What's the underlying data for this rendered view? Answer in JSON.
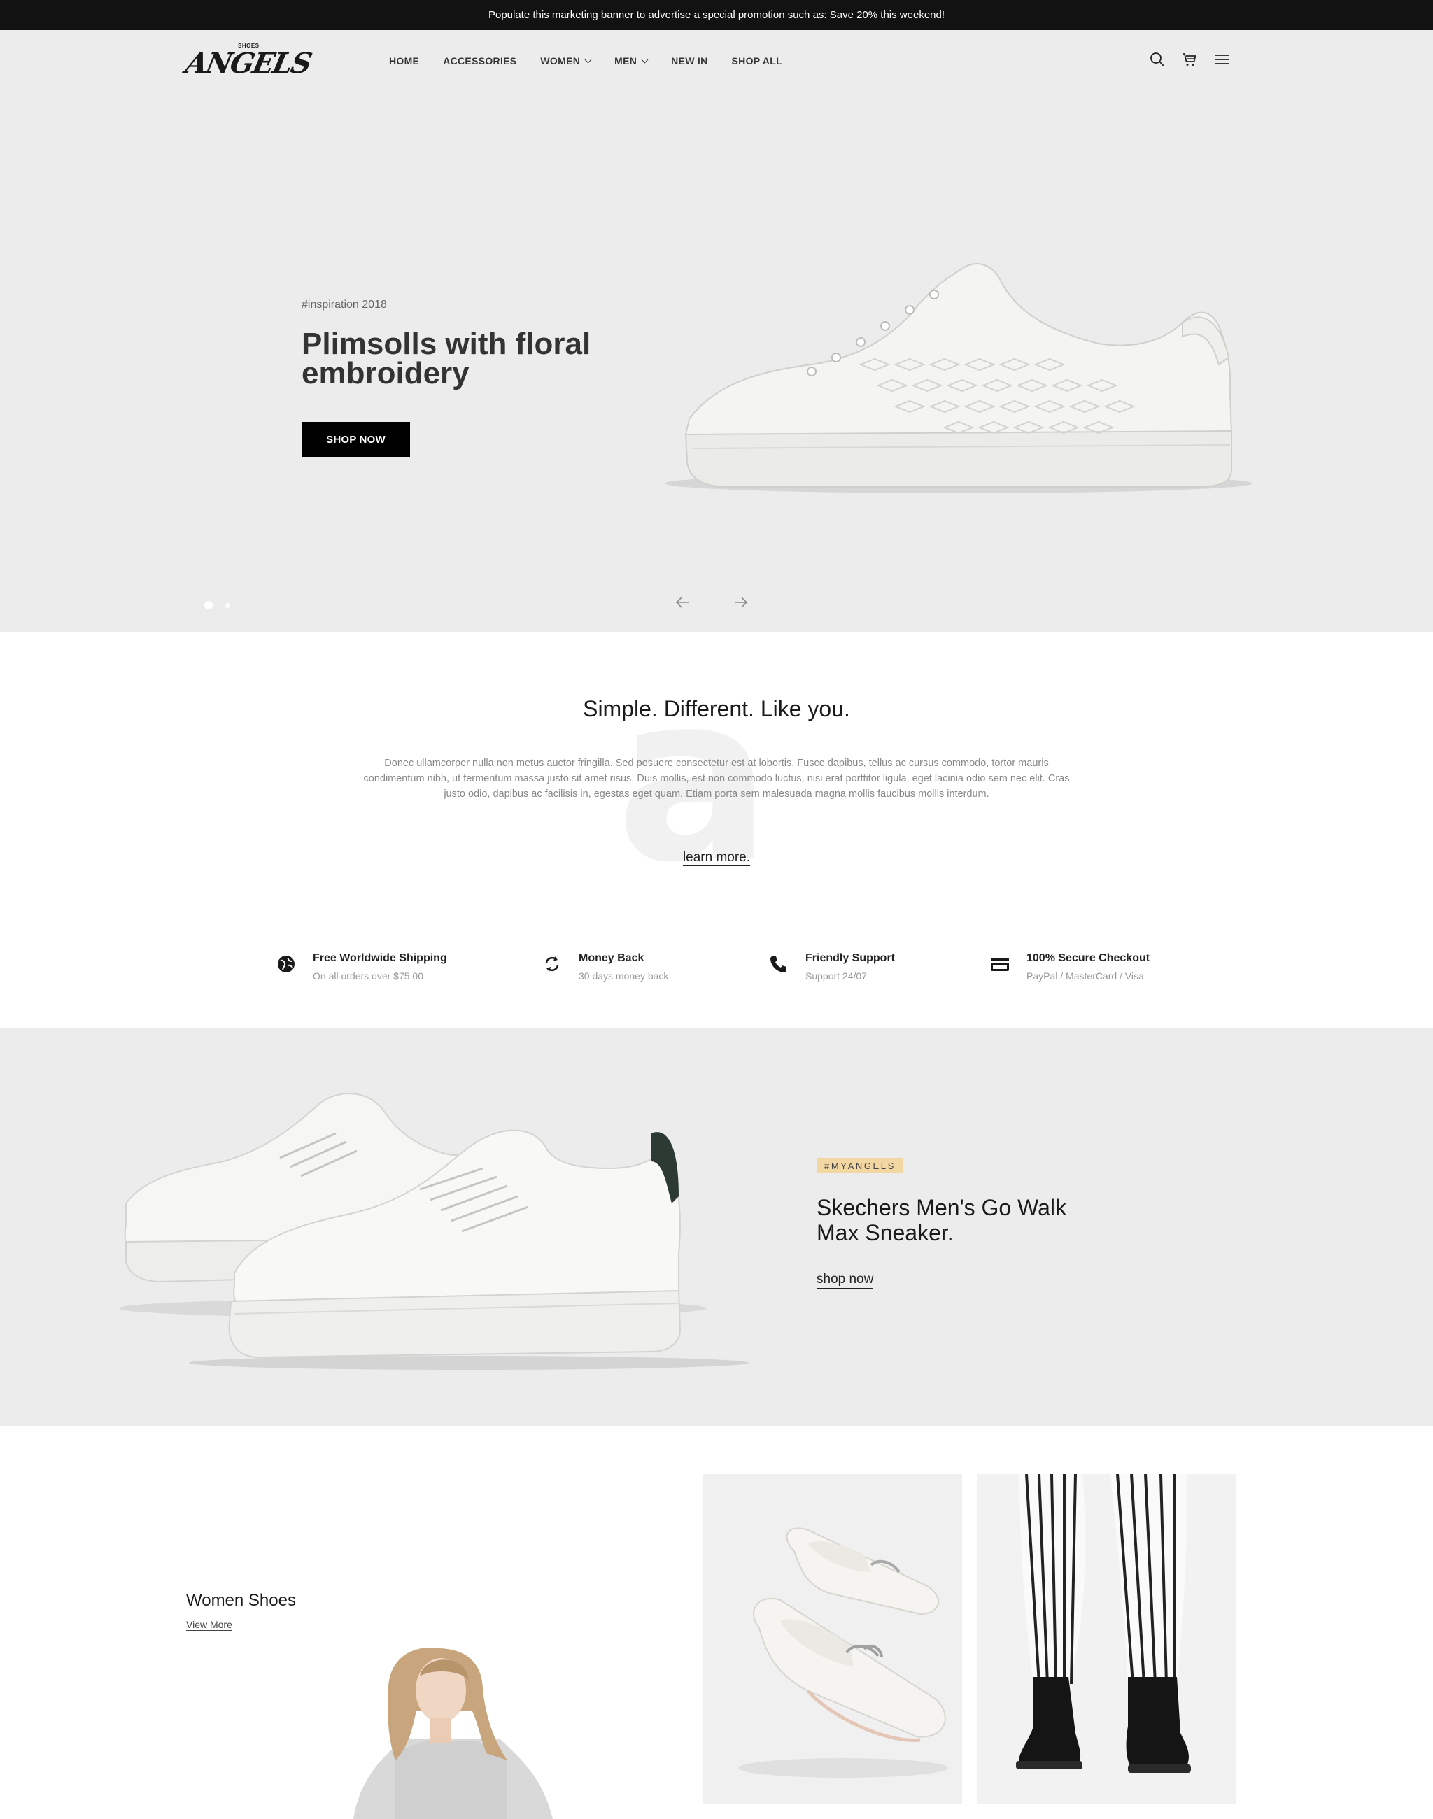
{
  "banner": {
    "text": "Populate this marketing banner to advertise a special promotion such as: Save 20% this weekend!"
  },
  "header": {
    "logo_small": "SHOES",
    "logo_word": "ANGELS",
    "nav": [
      "HOME",
      "ACCESSORIES",
      "WOMEN",
      "MEN",
      "NEW IN",
      "SHOP ALL"
    ],
    "icons": [
      "search-icon",
      "cart-icon",
      "menu-icon"
    ]
  },
  "hero": {
    "tag": "#inspiration 2018",
    "title": "Plimsolls with floral embroidery",
    "button": "SHOP NOW",
    "slides": 2,
    "active_slide": 1
  },
  "intro": {
    "watermark": "a",
    "title": "Simple. Different. Like you.",
    "text": "Donec ullamcorper nulla non metus auctor fringilla. Sed posuere consectetur est at lobortis. Fusce dapibus, tellus ac cursus commodo, tortor mauris condimentum nibh, ut fermentum massa justo sit amet risus. Duis mollis, est non commodo luctus, nisi erat porttitor ligula, eget lacinia odio sem nec elit. Cras justo odio, dapibus ac facilisis in, egestas eget quam. Etiam porta sem malesuada magna mollis faucibus mollis interdum.",
    "link": "learn more."
  },
  "features": [
    {
      "title": "Free Worldwide Shipping",
      "subtitle": "On all orders over $75.00",
      "icon": "globe-icon"
    },
    {
      "title": "Money Back",
      "subtitle": "30 days money back",
      "icon": "refresh-icon"
    },
    {
      "title": "Friendly Support",
      "subtitle": "Support 24/07",
      "icon": "phone-icon"
    },
    {
      "title": "100% Secure Checkout",
      "subtitle": "PayPal / MasterCard / Visa",
      "icon": "credit-card-icon"
    }
  ],
  "promo": {
    "badge": "#MYANGELS",
    "title": "Skechers Men's Go Walk Max Sneaker.",
    "link": "shop now"
  },
  "categories": {
    "title": "Women Shoes",
    "link": "View More"
  },
  "colors": {
    "banner_bg": "#121212",
    "section_bg": "#ececec",
    "badge_bg": "#f2d7a2",
    "button_bg": "#000000"
  }
}
